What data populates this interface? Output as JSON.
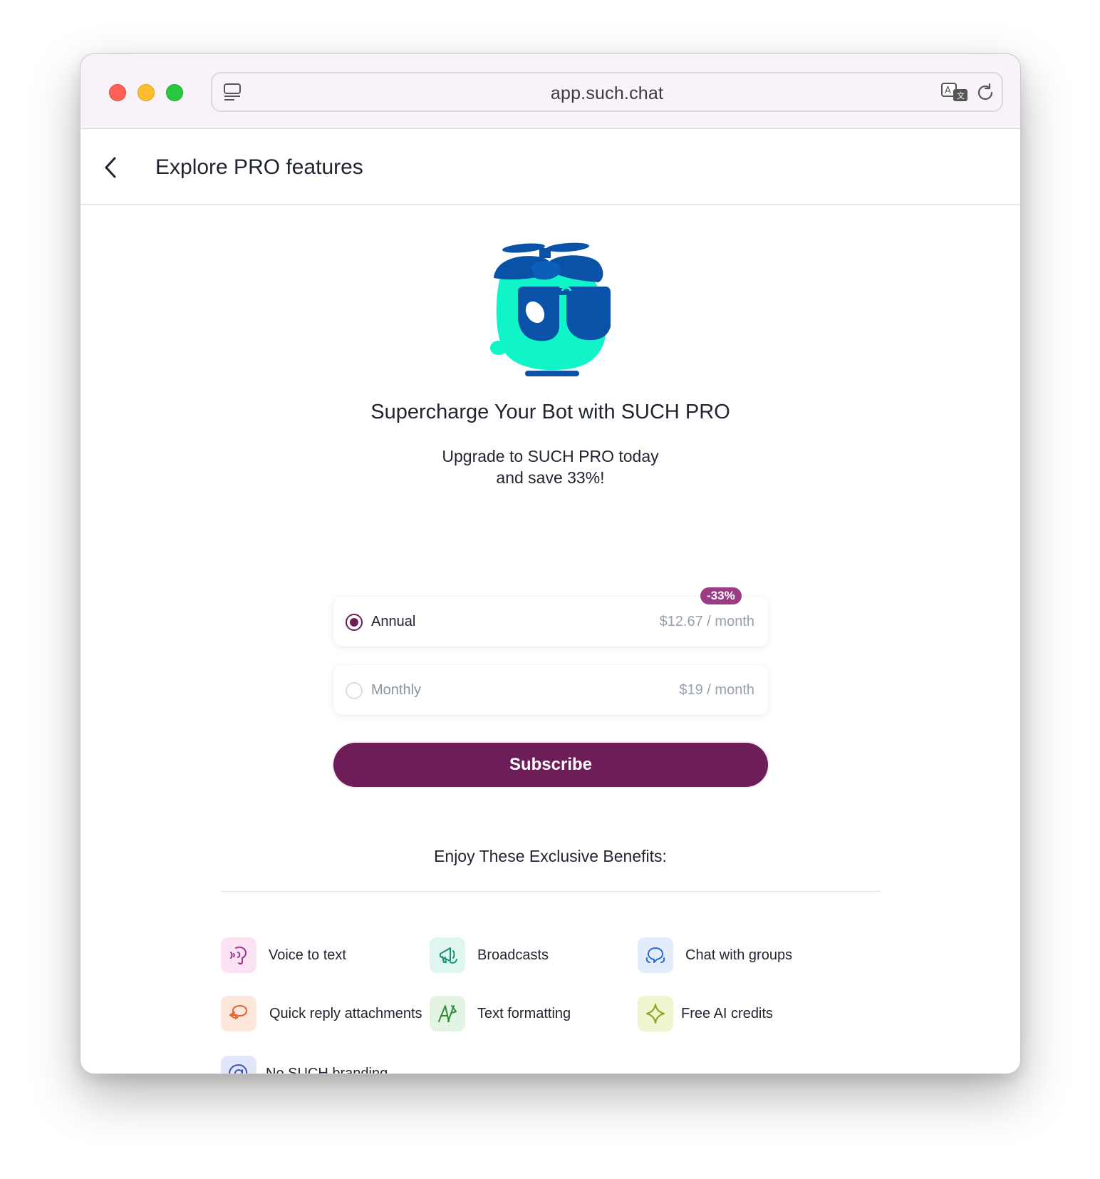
{
  "browser": {
    "url": "app.such.chat"
  },
  "header": {
    "title": "Explore PRO features"
  },
  "hero": {
    "title": "Supercharge Your Bot with SUCH PRO",
    "subtitle_line1": "Upgrade to SUCH PRO today",
    "subtitle_line2": "and save 33%!"
  },
  "plans": [
    {
      "label": "Annual",
      "price": "$12.67 / month",
      "selected": true,
      "badge": "-33%"
    },
    {
      "label": "Monthly",
      "price": "$19 / month",
      "selected": false
    }
  ],
  "subscribe_label": "Subscribe",
  "benefits": {
    "title": "Enjoy These Exclusive Benefits:",
    "items": [
      {
        "label": "Voice to text",
        "icon": "voice-icon",
        "color": "#a0328a",
        "bg": "#fbe3f3"
      },
      {
        "label": "Broadcasts",
        "icon": "megaphone-icon",
        "color": "#1a8f7a",
        "bg": "#dff5ef"
      },
      {
        "label": "Chat with groups",
        "icon": "group-chat-icon",
        "color": "#2a6ad0",
        "bg": "#e2edfb"
      },
      {
        "label": "Quick reply attachments",
        "icon": "quick-reply-icon",
        "color": "#e2632b",
        "bg": "#fde6dc"
      },
      {
        "label": "Text formatting",
        "icon": "text-format-icon",
        "color": "#2f8a3b",
        "bg": "#e3f4e2"
      },
      {
        "label": "Free AI credits",
        "icon": "sparkle-icon",
        "color": "#8aa21a",
        "bg": "#eef6cf"
      },
      {
        "label": "No SUCH branding",
        "icon": "at-sign-icon",
        "color": "#3e57b6",
        "bg": "#e3e6f8"
      }
    ]
  },
  "colors": {
    "accent": "#6d1d58",
    "badge": "#9b3c86",
    "mascot_body": "#10f5c8",
    "mascot_glasses": "#0a52a8"
  }
}
